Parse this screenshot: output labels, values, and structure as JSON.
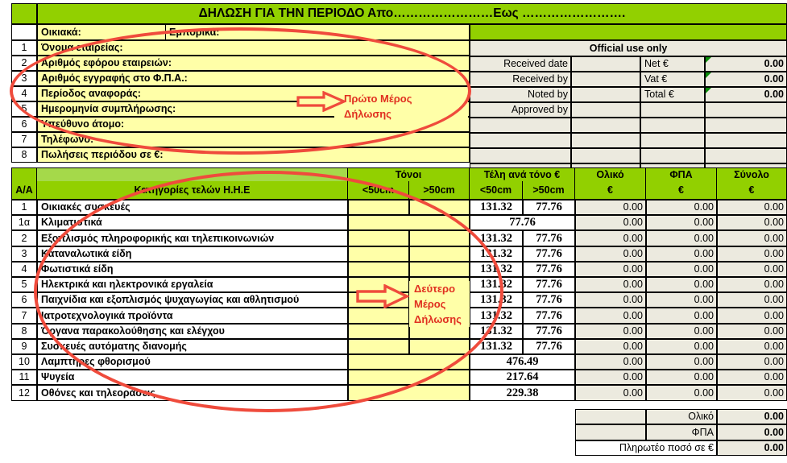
{
  "document": {
    "title": "ΔΗΛΩΣΗ ΓΙΑ ΤΗΝ ΠΕΡΙΟΔΟ Απο……………………Εως ……………………."
  },
  "form": {
    "toprow": {
      "residential_label": "Οικιακά:",
      "commercial_label": "Εμπορικά:"
    },
    "fields": [
      {
        "no": "1",
        "label": "Όνομα εταιρείας:",
        "value": ""
      },
      {
        "no": "2",
        "label": "Αριθμός εφόρου εταιρειών:",
        "value": ""
      },
      {
        "no": "3",
        "label": "Αριθμός εγγραφής στο Φ.Π.Α.:",
        "value": ""
      },
      {
        "no": "4",
        "label": "Περίοδος αναφοράς:",
        "value": ""
      },
      {
        "no": "5",
        "label": "Ημερομηνία συμπλήρωσης:",
        "value": ""
      },
      {
        "no": "6",
        "label": "Υπεύθυνο άτομο:",
        "value": ""
      },
      {
        "no": "7",
        "label": "Τηλέφωνο:",
        "value": ""
      },
      {
        "no": "8",
        "label": "Πωλήσεις περιόδου σε €:",
        "value": ""
      }
    ],
    "annotation_part1": {
      "line1": "Πρώτο Μέρος",
      "line2": "Δήλωσης"
    }
  },
  "official": {
    "heading": "Official use only",
    "rows": [
      {
        "label": "Received date",
        "value": "",
        "amount_label": "Net €",
        "amount": "0.00"
      },
      {
        "label": "Received by",
        "value": "",
        "amount_label": "Vat €",
        "amount": "0.00"
      },
      {
        "label": "Noted by",
        "value": "",
        "amount_label": "Total €",
        "amount": "0.00"
      },
      {
        "label": "Approved by",
        "value": "",
        "amount_label": "",
        "amount": ""
      }
    ]
  },
  "table": {
    "headers": {
      "aa": "A/A",
      "category": "Κατηγορίες τελών Η.Η.Ε",
      "tonnes_group": "Τόνοι",
      "tonnes_small": "<50cm",
      "tonnes_large": ">50cm",
      "fees_group": "Τέλη ανά τόνο €",
      "fees_small": "<50cm",
      "fees_large": ">50cm",
      "total_line1": "Ολικό",
      "total_line2": "€",
      "vat_line1": "ΦΠΑ",
      "vat_line2": "€",
      "sum_line1": "Σύνολο",
      "sum_line2": "€"
    },
    "annotation_part2": {
      "line1": "Δεύτερο",
      "line2": "Μέρος",
      "line3": "Δήλωσης"
    },
    "rows": [
      {
        "no": "1",
        "name": "Οικιακές συσκευές",
        "t_small": "",
        "t_large": "",
        "fee_small": "131.32",
        "fee_large": "77.76",
        "fee_merged": null,
        "total": "0.00",
        "vat": "0.00",
        "sum": "0.00"
      },
      {
        "no": "1α",
        "name": "Κλιματιστικά",
        "t_small": "",
        "t_large": "",
        "fee_small": null,
        "fee_large": null,
        "fee_merged": "77.76",
        "total": "0.00",
        "vat": "0.00",
        "sum": "0.00",
        "merged_tonnes": true
      },
      {
        "no": "2",
        "name": "Εξοπλισμός πληροφορικής και τηλεπικοινωνιών",
        "t_small": "",
        "t_large": "",
        "fee_small": "131.32",
        "fee_large": "77.76",
        "fee_merged": null,
        "total": "0.00",
        "vat": "0.00",
        "sum": "0.00"
      },
      {
        "no": "3",
        "name": "Καταναλωτικά είδη",
        "t_small": "",
        "t_large": "",
        "fee_small": "131.32",
        "fee_large": "77.76",
        "fee_merged": null,
        "total": "0.00",
        "vat": "0.00",
        "sum": "0.00"
      },
      {
        "no": "4",
        "name": "Φωτιστικά είδη",
        "t_small": "",
        "t_large": "",
        "fee_small": "131.32",
        "fee_large": "77.76",
        "fee_merged": null,
        "total": "0.00",
        "vat": "0.00",
        "sum": "0.00"
      },
      {
        "no": "5",
        "name": "Ηλεκτρικά και ηλεκτρονικά εργαλεία",
        "t_small": "",
        "t_large": "",
        "fee_small": "131.32",
        "fee_large": "77.76",
        "fee_merged": null,
        "total": "0.00",
        "vat": "0.00",
        "sum": "0.00"
      },
      {
        "no": "6",
        "name": "Παιχνίδια και εξοπλισμός ψυχαγωγίας και αθλητισμού",
        "t_small": "",
        "t_large": "",
        "fee_small": "131.32",
        "fee_large": "77.76",
        "fee_merged": null,
        "total": "0.00",
        "vat": "0.00",
        "sum": "0.00"
      },
      {
        "no": "7",
        "name": "Ιατροτεχνολογικά προϊόντα",
        "t_small": "",
        "t_large": "",
        "fee_small": "131.32",
        "fee_large": "77.76",
        "fee_merged": null,
        "total": "0.00",
        "vat": "0.00",
        "sum": "0.00"
      },
      {
        "no": "8",
        "name": "Όργανα παρακολούθησης και ελέγχου",
        "t_small": "",
        "t_large": "",
        "fee_small": "131.32",
        "fee_large": "77.76",
        "fee_merged": null,
        "total": "0.00",
        "vat": "0.00",
        "sum": "0.00"
      },
      {
        "no": "9",
        "name": "Συσκευές αυτόματης διανομής",
        "t_small": "",
        "t_large": "",
        "fee_small": "131.32",
        "fee_large": "77.76",
        "fee_merged": null,
        "total": "0.00",
        "vat": "0.00",
        "sum": "0.00"
      },
      {
        "no": "10",
        "name": "Λαμπτήρες φθορισμού",
        "t_small": "",
        "t_large": "",
        "fee_small": null,
        "fee_large": null,
        "fee_merged": "476.49",
        "total": "0.00",
        "vat": "0.00",
        "sum": "0.00",
        "merged_tonnes": true
      },
      {
        "no": "11",
        "name": "Ψυγεία",
        "t_small": "",
        "t_large": "",
        "fee_small": null,
        "fee_large": null,
        "fee_merged": "217.64",
        "total": "0.00",
        "vat": "0.00",
        "sum": "0.00",
        "merged_tonnes": true
      },
      {
        "no": "12",
        "name": "Οθόνες και τηλεοράσεις",
        "t_small": "",
        "t_large": "",
        "fee_small": null,
        "fee_large": null,
        "fee_merged": "229.38",
        "total": "0.00",
        "vat": "0.00",
        "sum": "0.00",
        "merged_tonnes": true
      }
    ]
  },
  "summary": [
    {
      "label": "Ολικό",
      "value": "0.00"
    },
    {
      "label": "ΦΠΑ",
      "value": "0.00"
    },
    {
      "label": "Πληρωτέο ποσό σε €",
      "value": "0.00"
    }
  ],
  "colors": {
    "green": "#92d000",
    "green_light": "#a5d94a",
    "yellow": "#ffffa8",
    "grey": "#eceadf",
    "annotation_red": "#e03020"
  }
}
